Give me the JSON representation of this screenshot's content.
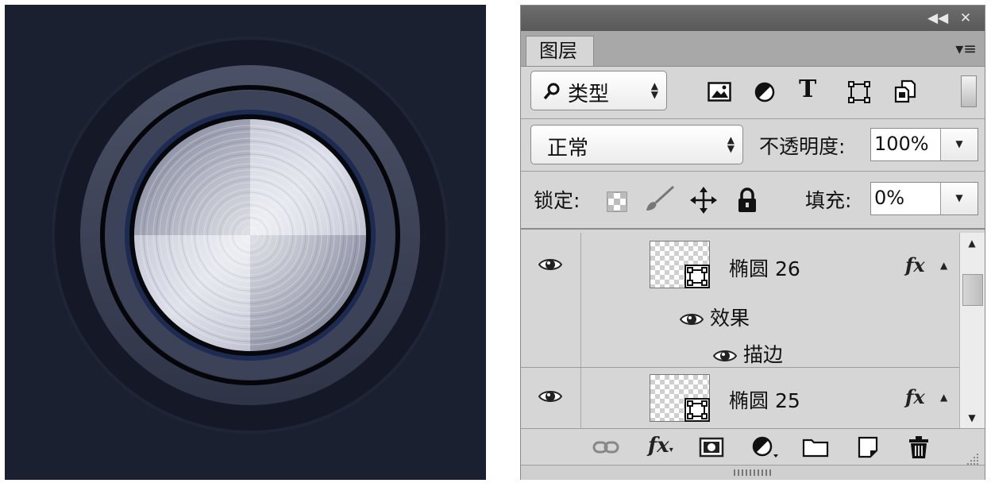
{
  "panel": {
    "tab_label": "图层",
    "filter": {
      "selected": "类型",
      "icons": [
        "image-filter-icon",
        "adjustment-filter-icon",
        "type-filter-icon",
        "shape-filter-icon",
        "smart-object-filter-icon"
      ]
    },
    "blend_mode": "正常",
    "opacity_label": "不透明度:",
    "opacity_value": "100%",
    "lock_label": "锁定:",
    "lock_icons": [
      "lock-transparent-icon",
      "lock-paint-icon",
      "lock-move-icon",
      "lock-all-icon"
    ],
    "fill_label": "填充:",
    "fill_value": "0%"
  },
  "layers": [
    {
      "name": "椭圆 26",
      "fx": "fx",
      "effects_label": "效果",
      "effects": [
        "描边"
      ]
    },
    {
      "name": "椭圆 25",
      "fx": "fx"
    }
  ],
  "bottom_toolbar": [
    "link-layers-icon",
    "fx-icon",
    "mask-icon",
    "adjustment-icon",
    "folder-icon",
    "new-layer-icon",
    "trash-icon"
  ],
  "colors": {
    "canvas_bg": "#1b2031",
    "panel_bg": "#d6d6d6",
    "titlebar": "#626262"
  }
}
